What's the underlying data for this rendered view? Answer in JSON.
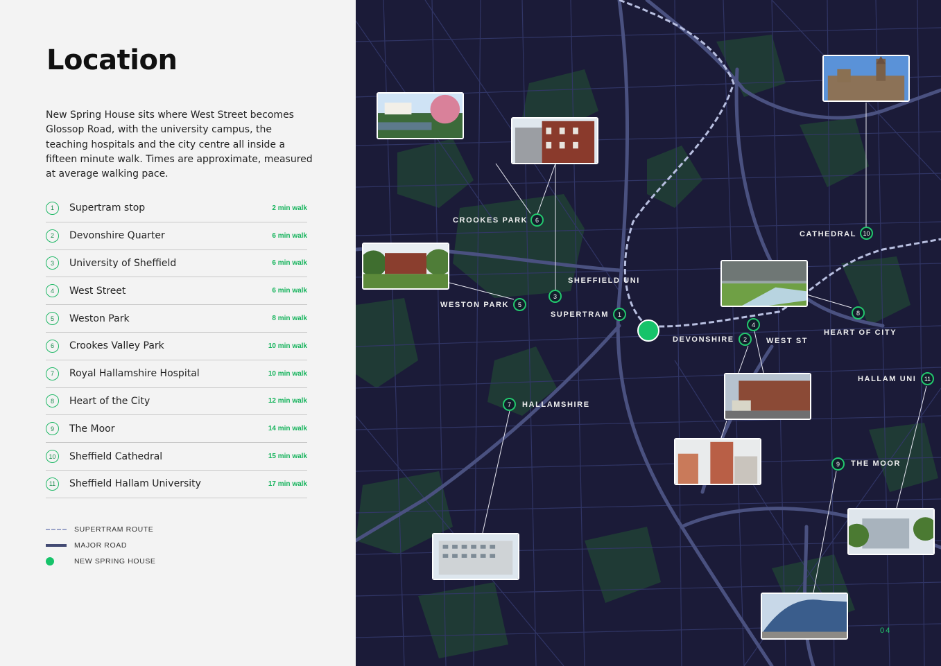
{
  "title": "Location",
  "intro": "New Spring House sits where West Street becomes Glossop Road, with the university campus, the teaching hospitals and the city centre all inside a fifteen minute walk. Times are approximate, measured at average walking pace.",
  "locations": [
    {
      "num": "1",
      "name": "Supertram stop",
      "walk": "2 min walk"
    },
    {
      "num": "2",
      "name": "Devonshire Quarter",
      "walk": "6 min walk"
    },
    {
      "num": "3",
      "name": "University of Sheffield",
      "walk": "6 min walk"
    },
    {
      "num": "4",
      "name": "West Street",
      "walk": "6 min walk"
    },
    {
      "num": "5",
      "name": "Weston Park",
      "walk": "8 min walk"
    },
    {
      "num": "6",
      "name": "Crookes Valley Park",
      "walk": "10 min walk"
    },
    {
      "num": "7",
      "name": "Royal Hallamshire Hospital",
      "walk": "10 min walk"
    },
    {
      "num": "8",
      "name": "Heart of the City",
      "walk": "12 min walk"
    },
    {
      "num": "9",
      "name": "The Moor",
      "walk": "14 min walk"
    },
    {
      "num": "10",
      "name": "Sheffield Cathedral",
      "walk": "15 min walk"
    },
    {
      "num": "11",
      "name": "Sheffield Hallam University",
      "walk": "17 min walk"
    }
  ],
  "legend": {
    "supertram": "SUPERTRAM ROUTE",
    "major_road": "MAJOR ROAD",
    "new_spring_house": "NEW SPRING HOUSE"
  },
  "map": {
    "labels": {
      "crookes_park": "CROOKES PARK",
      "sheffield_uni": "SHEFFIELD UNI",
      "weston_park": "WESTON PARK",
      "supertram": "SUPERTRAM",
      "devonshire": "DEVONSHIRE",
      "west_st": "WEST ST",
      "cathedral": "CATHEDRAL",
      "heart_of_city": "HEART OF CITY",
      "hallam_uni": "HALLAM UNI",
      "hallamshire": "HALLAMSHIRE",
      "the_moor": "THE MOOR"
    },
    "markers": {
      "m1": "1",
      "m2": "2",
      "m3": "3",
      "m4": "4",
      "m5": "5",
      "m6": "6",
      "m7": "7",
      "m8": "8",
      "m9": "9",
      "m10": "10",
      "m11": "11"
    },
    "colors": {
      "background": "#1b1b38",
      "streets": "#3a3f6e",
      "major_roads": "#4a5180",
      "parks": "#1f3a35",
      "accent": "#22c86d",
      "tram": "#b8bfe0"
    }
  },
  "page_number": "04"
}
